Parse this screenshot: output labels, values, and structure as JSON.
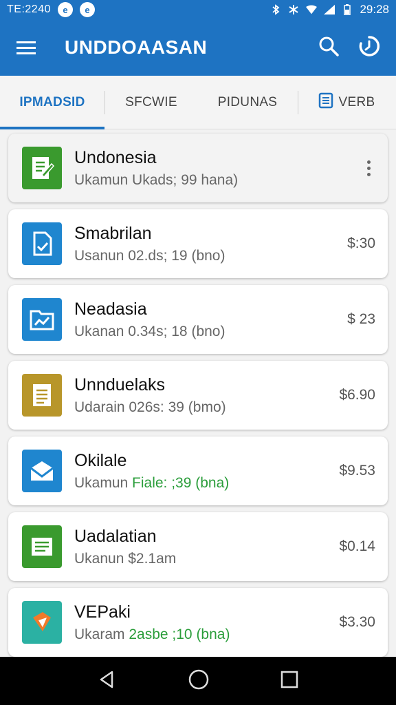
{
  "status_bar": {
    "left_text": "TE:2240",
    "clock": "29:28",
    "badge_1": "e",
    "badge_2": "e"
  },
  "app_bar": {
    "title": "UNDDOAASAN"
  },
  "tabs": [
    {
      "label": "IPMADSID",
      "active": true
    },
    {
      "label": "SFCWIE",
      "active": false
    },
    {
      "label": "PIDUNAS",
      "active": false
    },
    {
      "label": "VERB",
      "active": false
    }
  ],
  "items": [
    {
      "name": "Undonesia",
      "sub": "Ukamun Ukads; 99 hana)",
      "price": "",
      "icon": "edit-doc-icon",
      "color": "#3a9a2e",
      "selected": true
    },
    {
      "name": "Smabrilan",
      "sub": "Usanun 02.ds; 19 (bno)",
      "price": "$:30",
      "icon": "doc-check-icon",
      "color": "#1f86cf"
    },
    {
      "name": "Neadasia",
      "sub": "Ukanan 0.34s; 18 (bno)",
      "price": "$ 23",
      "icon": "folder-chart-icon",
      "color": "#1f86cf"
    },
    {
      "name": "Unnduelaks",
      "sub": "Udarain 026s: 39 (bmo)",
      "price": "$6.90",
      "icon": "note-lines-icon",
      "color": "#b8962a"
    },
    {
      "name": "Okilale",
      "sub_pre": "Ukamun ",
      "sub_hl": "Fiale: ;39 (bna)",
      "price": "$9.53",
      "icon": "mail-icon",
      "color": "#1f86cf"
    },
    {
      "name": "Uadalatian",
      "sub": "Ukanun $2.1am",
      "price": "$0.14",
      "icon": "list-doc-icon",
      "color": "#3a9a2e"
    },
    {
      "name": "VEPaki",
      "sub_pre": "Ukaram ",
      "sub_hl": "2asbe ;10 (bna)",
      "price": "$3.30",
      "icon": "pen-box-icon",
      "color": "#2bb1a3"
    }
  ]
}
